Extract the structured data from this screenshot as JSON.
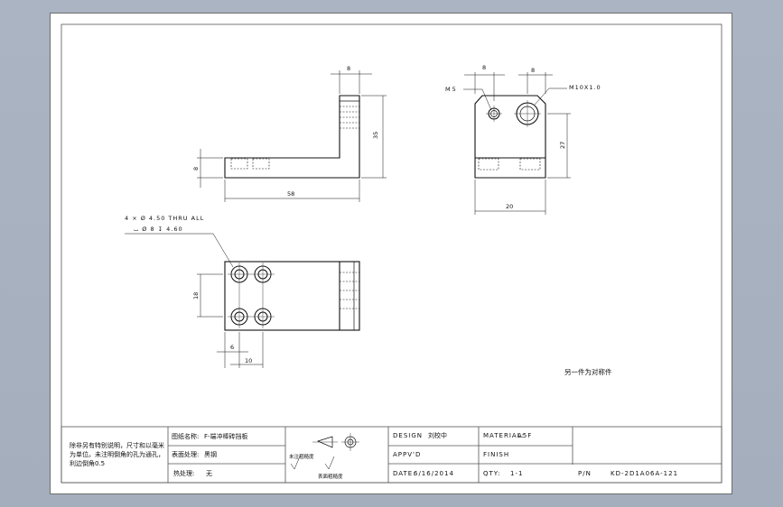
{
  "callouts": {
    "m5": "M5",
    "m10": "M10X1.0",
    "hole_line1": "4 × Ø 4.50 THRU ALL",
    "hole_line2": "⌴ Ø 8 ↧ 4.60"
  },
  "dimensions": {
    "front_top_width": "8",
    "front_height": "35",
    "front_foot": "8",
    "front_length": "58",
    "side_top_left": "8",
    "side_top_right": "8",
    "side_height": "27",
    "side_width": "20",
    "bottom_height": "18",
    "bottom_small": "6",
    "bottom_pitch": "10"
  },
  "annotation": "另一件为对称件",
  "title_block": {
    "tech_note": [
      "除非另有特别说明，尺寸和以毫米",
      "为单位。未注明倒角的孔为通孔，",
      "利边倒角0.5"
    ],
    "part_name_label": "图纸名称:",
    "part_name": "F-端冲棒砖挡板",
    "surface_label": "表面处理:",
    "surface": "黑钢",
    "heat_label": "热处理:",
    "heat": "无",
    "roughness_label": "未注粗糙度",
    "surface_finish_label": "表面粗糙度",
    "design_label": "DESIGN",
    "design": "刘校中",
    "appvd_label": "APPV'D",
    "date_label": "DATE:",
    "date": "6/16/2014",
    "material_label": "MATERIAL:",
    "material": "A5F",
    "finish_label": "FINISH",
    "qty_label": "QTY:",
    "qty": "1-1",
    "pn_label": "P/N",
    "pn": "KD-2D1A06A-121"
  }
}
